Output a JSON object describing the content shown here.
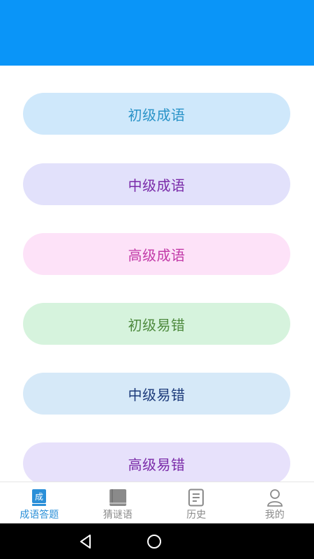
{
  "colors": {
    "app_bar": "#0a95f8",
    "tab_active": "#2a8fd8",
    "tab_inactive": "#8a8a8a"
  },
  "levels": [
    {
      "label": "初级成语",
      "bg": "#cfe8fb",
      "fg": "#2a93c8"
    },
    {
      "label": "中级成语",
      "bg": "#e2e1fb",
      "fg": "#7a2aa8"
    },
    {
      "label": "高级成语",
      "bg": "#fde2f8",
      "fg": "#c23aa8"
    },
    {
      "label": "初级易错",
      "bg": "#d6f3dd",
      "fg": "#4e8a3e"
    },
    {
      "label": "中级易错",
      "bg": "#d6e9f8",
      "fg": "#1c3a7a"
    },
    {
      "label": "高级易错",
      "bg": "#e7e1fb",
      "fg": "#7a2aa8"
    }
  ],
  "tabs": [
    {
      "label": "成语答题",
      "icon": "idiom-book-icon",
      "active": true,
      "glyph": "成"
    },
    {
      "label": "猜谜语",
      "icon": "closed-book-icon",
      "active": false
    },
    {
      "label": "历史",
      "icon": "document-icon",
      "active": false
    },
    {
      "label": "我的",
      "icon": "user-icon",
      "active": false
    }
  ],
  "system_nav": {
    "back": "back-icon",
    "home": "home-icon"
  }
}
